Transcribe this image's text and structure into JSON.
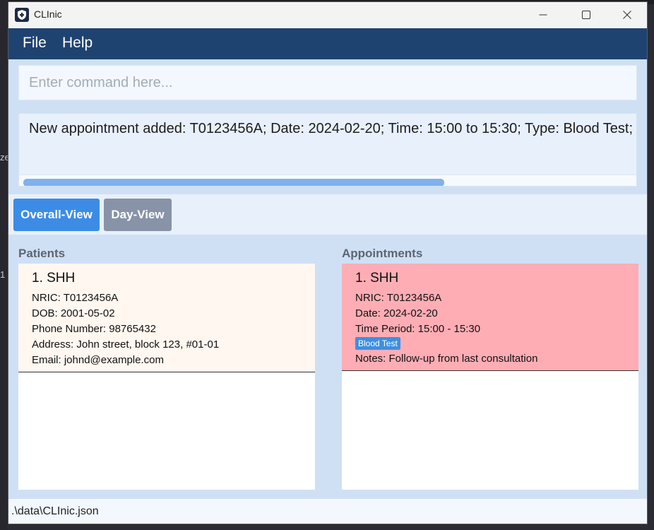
{
  "window": {
    "title": "CLInic",
    "icon": "shield-icon"
  },
  "desktop": {
    "edge_chars": [
      "ze",
      "1"
    ]
  },
  "menu": {
    "file": "File",
    "help": "Help"
  },
  "command": {
    "placeholder": "Enter command here..."
  },
  "result": {
    "text": "New appointment added: T0123456A; Date: 2024-02-20; Time: 15:00 to 15:30; Type: Blood Test;",
    "scroll_fraction": 0.69
  },
  "views": {
    "overall": "Overall-View",
    "day": "Day-View",
    "active_color": "#3c8ce6",
    "inactive_color": "#8893a8"
  },
  "patients": {
    "title": "Patients",
    "items": [
      {
        "header": "1.  SHH",
        "nric": "NRIC: T0123456A",
        "dob": "DOB: 2001-05-02",
        "phone": "Phone Number: 98765432",
        "address": "Address: John street, block 123, #01-01",
        "email": "Email: johnd@example.com"
      }
    ],
    "card_color": "#fff7f0"
  },
  "appointments": {
    "title": "Appointments",
    "items": [
      {
        "header": "1.  SHH",
        "nric": "NRIC: T0123456A",
        "date": "Date: 2024-02-20",
        "time": "Time Period: 15:00 - 15:30",
        "tag": "Blood Test",
        "notes": "Notes: Follow-up from last consultation"
      }
    ],
    "card_color": "#ffadb5"
  },
  "status": {
    "path": ".\\data\\CLInic.json"
  }
}
